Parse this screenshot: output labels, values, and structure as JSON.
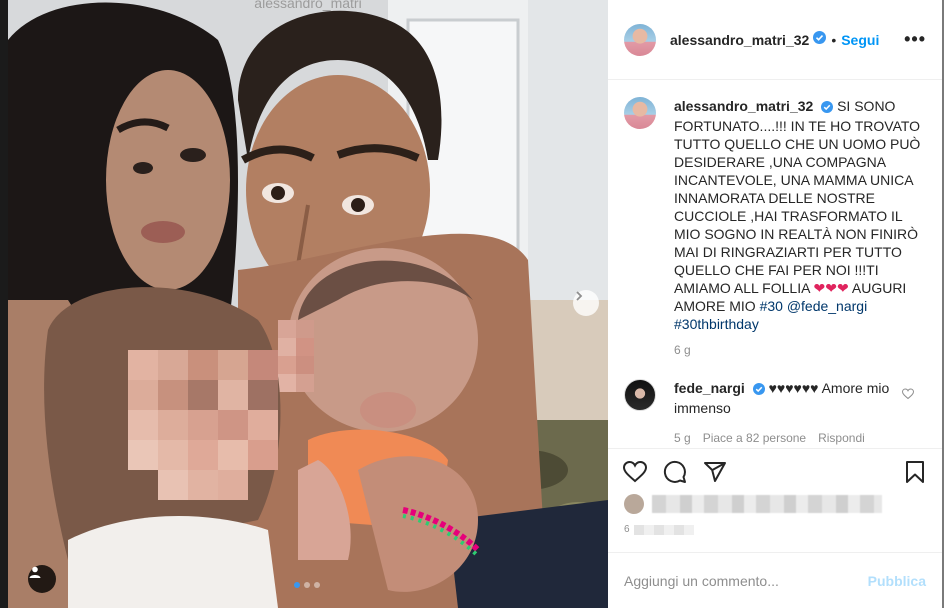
{
  "post": {
    "username": "alessandro_matri_32",
    "follow_label": "Segui",
    "separator": "•",
    "more_label": "•••"
  },
  "caption": {
    "username": "alessandro_matri_32",
    "text": "SI SONO FORTUNATO....!!! IN TE HO TROVATO TUTTO QUELLO CHE UN UOMO PUÒ DESIDERARE ,UNA COMPAGNA INCANTEVOLE, UNA MAMMA UNICA INNAMORATA DELLE NOSTRE CUCCIOLE ,HAI TRASFORMATO IL MIO SOGNO IN REALTÀ NON FINIRÒ MAI DI RINGRAZIARTI PER TUTTO QUELLO CHE FAI PER NOI !!!TI AMIAMO ALL FOLLIA",
    "hearts": "❤❤❤",
    "text_after": "AUGURI AMORE MIO",
    "tags": [
      "#30",
      "@fede_nargi",
      "#30thbirthday"
    ],
    "age": "6 g"
  },
  "comment": {
    "username": "fede_nargi",
    "hearts": "♥♥♥♥♥♥",
    "text": "Amore mio immenso",
    "age": "5 g",
    "likes": "Piace a 82 persone",
    "reply": "Rispondi"
  },
  "footer": {
    "time_label": "6",
    "input_placeholder": "Aggiungi un commento...",
    "publish_label": "Pubblica"
  },
  "carousel": {
    "count": 3,
    "active": 0
  },
  "colors": {
    "accent": "#0095f6",
    "verified": "#3897f0",
    "heart": "#e0245e",
    "publish_disabled": "#b2dffc"
  },
  "icons": [
    "chevron-right-icon",
    "user-tag-icon",
    "verified-badge-icon",
    "more-icon",
    "heart-icon",
    "comment-icon",
    "share-icon",
    "bookmark-icon"
  ]
}
